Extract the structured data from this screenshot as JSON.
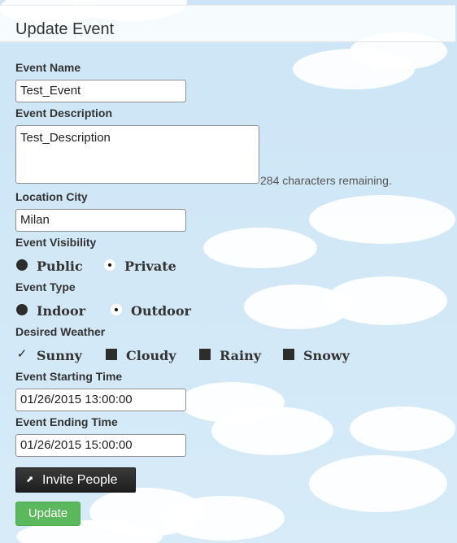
{
  "header": {
    "title": "Update Event"
  },
  "form": {
    "event_name": {
      "label": "Event Name",
      "value": "Test_Event"
    },
    "event_description": {
      "label": "Event Description",
      "value": "Test_Description",
      "remaining": "284 characters remaining."
    },
    "location_city": {
      "label": "Location City",
      "value": "Milan"
    },
    "event_visibility": {
      "label": "Event Visibility",
      "options": [
        "Public",
        "Private"
      ],
      "selected": "Private"
    },
    "event_type": {
      "label": "Event Type",
      "options": [
        "Indoor",
        "Outdoor"
      ],
      "selected": "Outdoor"
    },
    "desired_weather": {
      "label": "Desired Weather",
      "options": [
        "Sunny",
        "Cloudy",
        "Rainy",
        "Snowy"
      ],
      "checked": [
        "Sunny"
      ]
    },
    "start_time": {
      "label": "Event Starting Time",
      "value": "01/26/2015 13:00:00"
    },
    "end_time": {
      "label": "Event Ending Time",
      "value": "01/26/2015 15:00:00"
    }
  },
  "actions": {
    "invite_label": "Invite People",
    "update_label": "Update"
  },
  "icons": {
    "invite": "external-link-icon"
  },
  "colors": {
    "update_button": "#5cb85c",
    "invite_button": "#2a2a2a",
    "sky": "#cfe6f5"
  }
}
